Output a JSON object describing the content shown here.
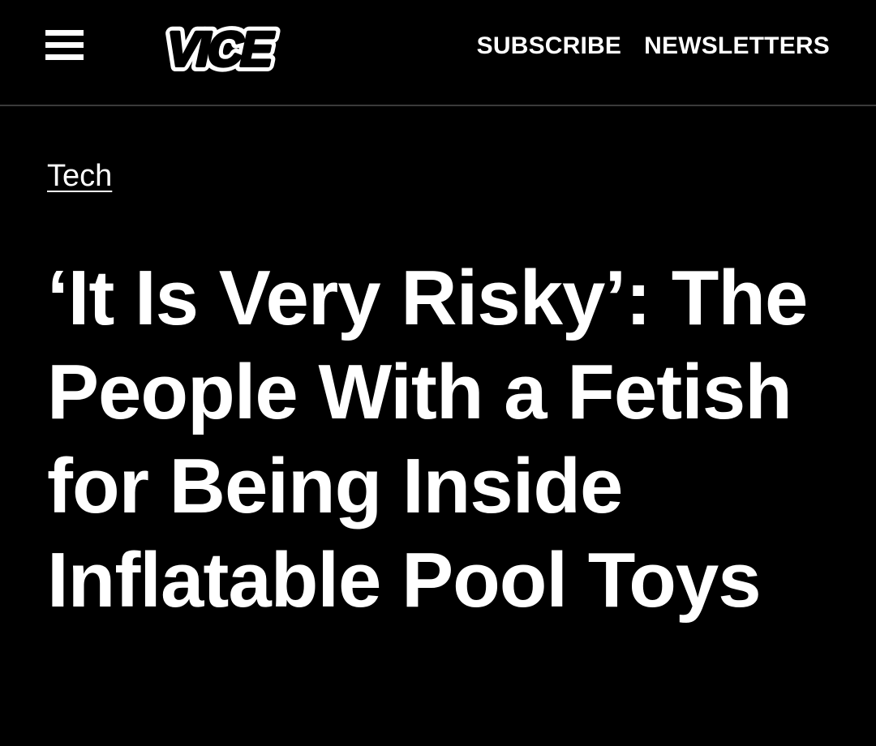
{
  "header": {
    "menu_icon": "hamburger-menu-icon",
    "logo_text": "VICE",
    "nav": [
      {
        "label": "SUBSCRIBE"
      },
      {
        "label": "NEWSLETTERS"
      }
    ]
  },
  "article": {
    "category": "Tech",
    "headline": "‘It Is Very Risky’: The People With a Fetish for Being Inside Inflatable Pool Toys"
  },
  "colors": {
    "background": "#000000",
    "text": "#ffffff",
    "divider": "#3a3a3a"
  }
}
